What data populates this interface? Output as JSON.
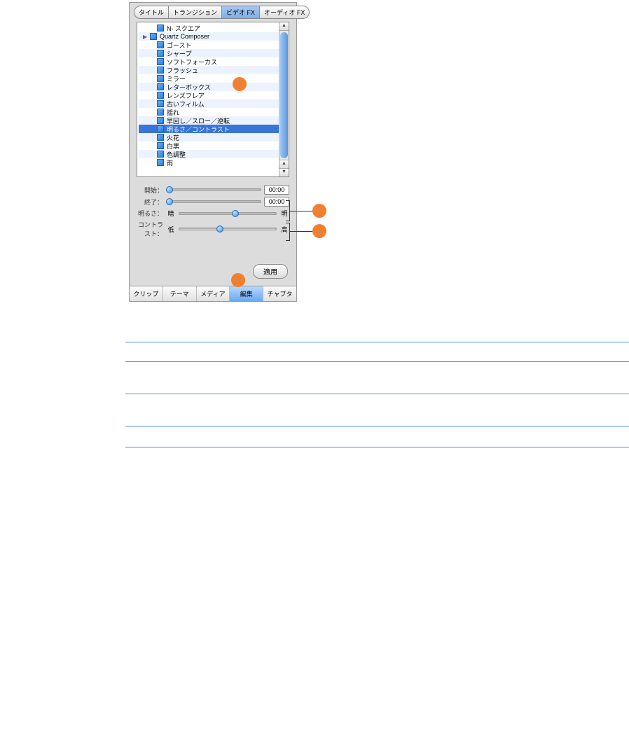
{
  "topTabs": [
    "タイトル",
    "トランジション",
    "ビデオ FX",
    "オーディオ FX"
  ],
  "topTabActive": 2,
  "effects": [
    {
      "label": "N- スクエア",
      "indent": 1
    },
    {
      "label": "Quartz Composer",
      "indent": 0,
      "disclosure": "▶"
    },
    {
      "label": "ゴースト",
      "indent": 1
    },
    {
      "label": "シャープ",
      "indent": 1
    },
    {
      "label": "ソフトフォーカス",
      "indent": 1
    },
    {
      "label": "フラッシュ",
      "indent": 1
    },
    {
      "label": "ミラー",
      "indent": 1
    },
    {
      "label": "レターボックス",
      "indent": 1
    },
    {
      "label": "レンズフレア",
      "indent": 1
    },
    {
      "label": "古いフィルム",
      "indent": 1
    },
    {
      "label": "揺れ",
      "indent": 1
    },
    {
      "label": "早回し／スロー／逆転",
      "indent": 1
    },
    {
      "label": "明るさ／コントラスト",
      "indent": 1,
      "selected": true
    },
    {
      "label": "火花",
      "indent": 1
    },
    {
      "label": "白黒",
      "indent": 1
    },
    {
      "label": "色調整",
      "indent": 1
    },
    {
      "label": "雨",
      "indent": 1
    }
  ],
  "sliders": {
    "start": {
      "label": "開始：",
      "value": "00:00",
      "pos": 0
    },
    "end": {
      "label": "終了：",
      "value": "00:00",
      "pos": 0
    },
    "brightness": {
      "label": "明るさ：",
      "left": "暗",
      "right": "明",
      "pos": 58
    },
    "contrast": {
      "label": "コントラスト：",
      "left": "低",
      "right": "高",
      "pos": 42
    }
  },
  "applyLabel": "適用",
  "bottomTabs": [
    "クリップ",
    "テーマ",
    "メディア",
    "編集",
    "チャプタ"
  ],
  "bottomTabActive": 3
}
